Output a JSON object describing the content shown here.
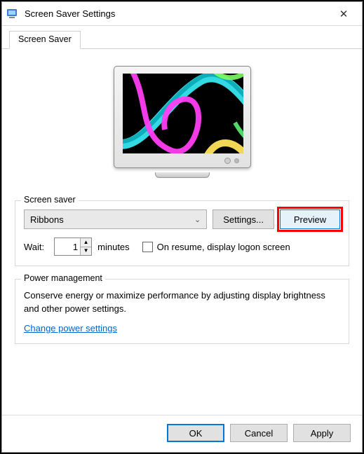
{
  "window": {
    "title": "Screen Saver Settings",
    "close_label": "✕"
  },
  "tab": {
    "label": "Screen Saver"
  },
  "screensaver_group": {
    "label": "Screen saver",
    "dropdown_value": "Ribbons",
    "settings_label": "Settings...",
    "preview_label": "Preview",
    "wait_label": "Wait:",
    "wait_value": "1",
    "minutes_label": "minutes",
    "resume_label": "On resume, display logon screen"
  },
  "power_group": {
    "label": "Power management",
    "text": "Conserve energy or maximize performance by adjusting display brightness and other power settings.",
    "link": "Change power settings"
  },
  "buttons": {
    "ok": "OK",
    "cancel": "Cancel",
    "apply": "Apply"
  }
}
